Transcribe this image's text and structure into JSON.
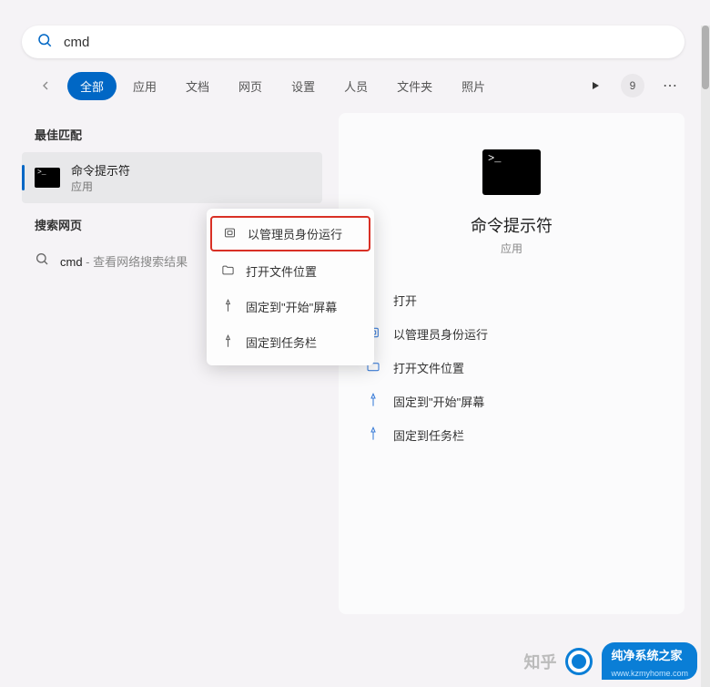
{
  "search": {
    "query": "cmd"
  },
  "filters": {
    "items": [
      "全部",
      "应用",
      "文档",
      "网页",
      "设置",
      "人员",
      "文件夹",
      "照片"
    ],
    "active_index": 0,
    "badge_count": "9"
  },
  "results": {
    "best_match_header": "最佳匹配",
    "best_match": {
      "title": "命令提示符",
      "subtype": "应用"
    },
    "web_header": "搜索网页",
    "web_item": {
      "term": "cmd",
      "suffix": " - 查看网络搜索结果"
    }
  },
  "context_menu": {
    "items": [
      {
        "key": "run-as-admin",
        "label": "以管理员身份运行",
        "highlighted": true
      },
      {
        "key": "open-location",
        "label": "打开文件位置"
      },
      {
        "key": "pin-start",
        "label": "固定到\"开始\"屏幕"
      },
      {
        "key": "pin-taskbar",
        "label": "固定到任务栏"
      }
    ]
  },
  "preview": {
    "title": "命令提示符",
    "subtype": "应用",
    "actions": [
      {
        "key": "open",
        "label": "打开"
      },
      {
        "key": "run-as-admin",
        "label": "以管理员身份运行"
      },
      {
        "key": "open-location",
        "label": "打开文件位置"
      },
      {
        "key": "pin-start",
        "label": "固定到\"开始\"屏幕"
      },
      {
        "key": "pin-taskbar",
        "label": "固定到任务栏"
      }
    ]
  },
  "watermark": {
    "zhihu": "知乎",
    "brand": "纯净系统之家",
    "url": "www.kzmyhome.com"
  }
}
